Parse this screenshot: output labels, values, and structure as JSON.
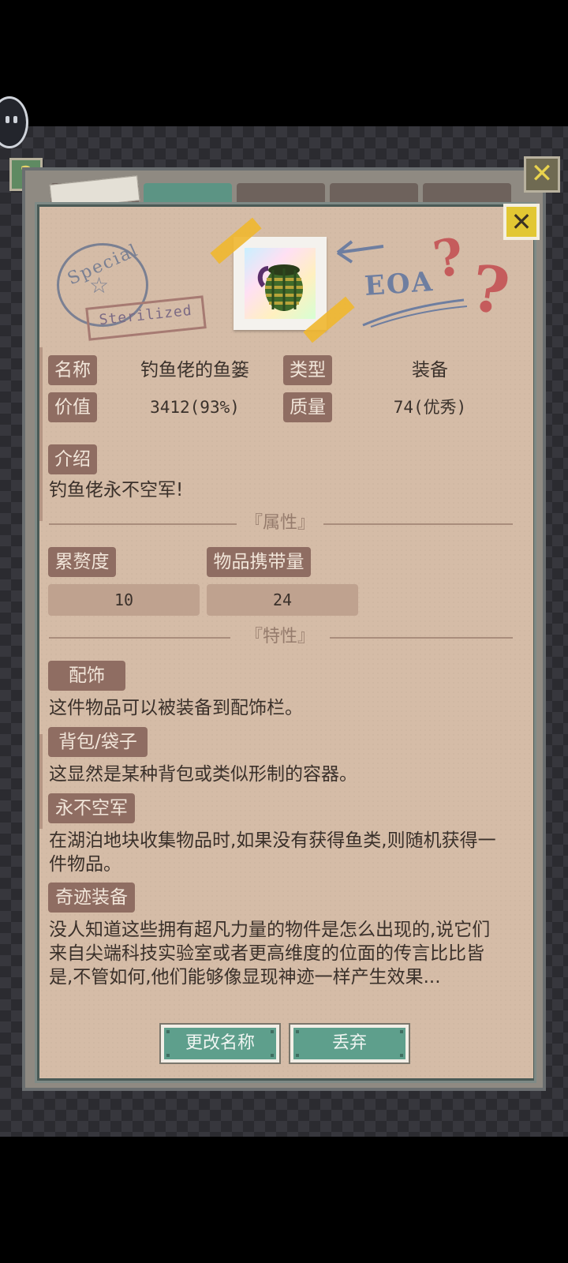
{
  "help_button": {
    "label": "?"
  },
  "close_buttons": {
    "outer": "✕",
    "inner": "✕"
  },
  "stamp": {
    "text": "Special",
    "star": "☆",
    "sterilized": "Sterilized"
  },
  "doodle": {
    "text": "EOA",
    "q1": "?",
    "q2": "?"
  },
  "item_info": {
    "name_label": "名称",
    "name_value": "钓鱼佬的鱼篓",
    "type_label": "类型",
    "type_value": "装备",
    "value_label": "价值",
    "value_value": "3412(93%)",
    "quality_label": "质量",
    "quality_value": "74(优秀)"
  },
  "intro": {
    "label": "介绍",
    "text": "钓鱼佬永不空军!"
  },
  "attributes": {
    "section_title": "『属性』",
    "stats": [
      {
        "label": "累赘度",
        "value": "10"
      },
      {
        "label": "物品携带量",
        "value": "24"
      }
    ]
  },
  "traits": {
    "section_title": "『特性』",
    "items": [
      {
        "label": "配饰",
        "description": "这件物品可以被装备到配饰栏。"
      },
      {
        "label": "背包/袋子",
        "description": "这显然是某种背包或类似形制的容器。"
      },
      {
        "label": "永不空军",
        "description": "在湖泊地块收集物品时,如果没有获得鱼类,则随机获得一件物品。"
      },
      {
        "label": "奇迹装备",
        "description": "没人知道这些拥有超凡力量的物件是怎么出现的,说它们来自尖端科技实验室或者更高维度的位面的传言比比皆是,不管如何,他们能够像显现神迹一样产生效果..."
      }
    ]
  },
  "actions": {
    "rename": "更改名称",
    "discard": "丢弃"
  },
  "colors": {
    "tag_bg": "#8f6d62",
    "paper": "#d5bca7",
    "button": "#5e9f8c",
    "close": "#e2c733"
  }
}
